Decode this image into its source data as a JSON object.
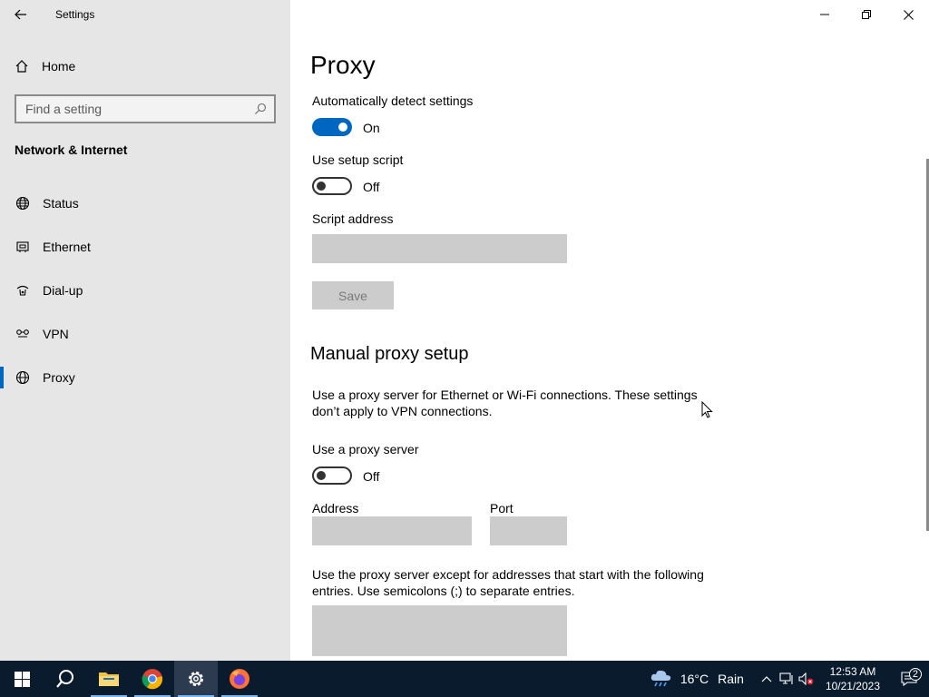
{
  "window": {
    "title": "Settings"
  },
  "sidebar": {
    "home_label": "Home",
    "search_placeholder": "Find a setting",
    "section_title": "Network & Internet",
    "items": [
      {
        "label": "Status",
        "icon": "globe-icon"
      },
      {
        "label": "Ethernet",
        "icon": "ethernet-icon"
      },
      {
        "label": "Dial-up",
        "icon": "dialup-icon"
      },
      {
        "label": "VPN",
        "icon": "vpn-icon"
      },
      {
        "label": "Proxy",
        "icon": "globe-icon",
        "active": true
      }
    ]
  },
  "main": {
    "title": "Proxy",
    "auto_detect": {
      "label": "Automatically detect settings",
      "state": "On"
    },
    "setup_script": {
      "label": "Use setup script",
      "state": "Off"
    },
    "script_address": {
      "label": "Script address",
      "value": ""
    },
    "save_label": "Save",
    "manual_heading": "Manual proxy setup",
    "manual_desc": "Use a proxy server for Ethernet or Wi-Fi connections. These settings don’t apply to VPN connections.",
    "use_proxy": {
      "label": "Use a proxy server",
      "state": "Off"
    },
    "address": {
      "label": "Address",
      "value": ""
    },
    "port": {
      "label": "Port",
      "value": ""
    },
    "exceptions_desc": "Use the proxy server except for addresses that start with the following entries. Use semicolons (;) to separate entries.",
    "exceptions_value": ""
  },
  "taskbar": {
    "weather_temp": "16°C",
    "weather_cond": "Rain",
    "time": "12:53 AM",
    "date": "10/21/2023",
    "notification_count": "2"
  },
  "colors": {
    "accent": "#0067c0",
    "sidebar_bg": "#e6e6e6",
    "taskbar_bg": "#0b1b2e",
    "field_bg": "#cccccc"
  }
}
